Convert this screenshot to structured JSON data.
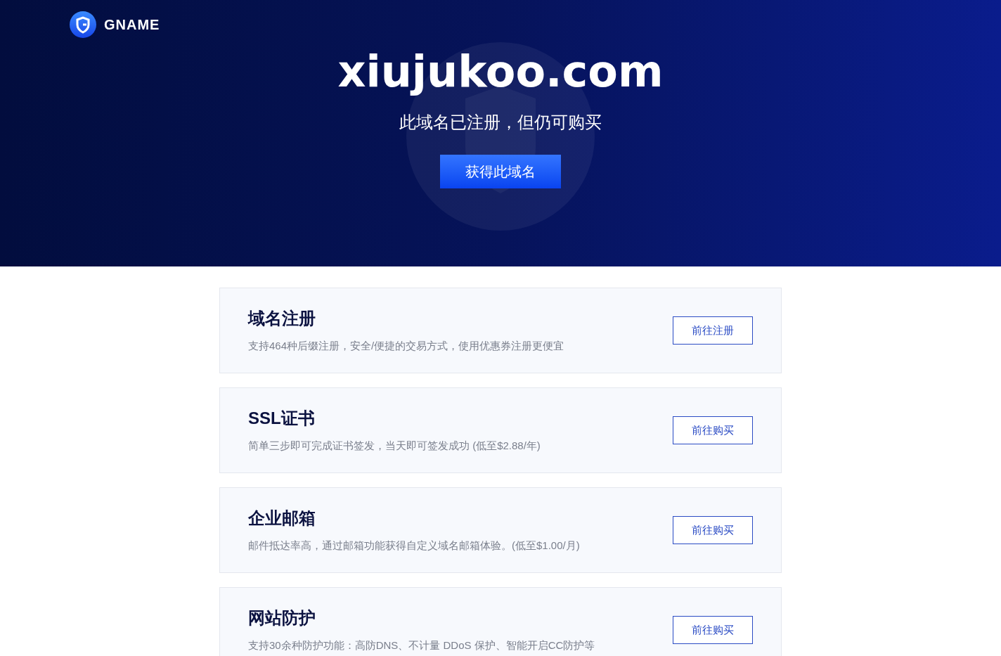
{
  "header": {
    "logo_text": "GNAME"
  },
  "hero": {
    "domain": "xiujukoo.com",
    "subtitle": "此域名已注册，但仍可购买",
    "button": "获得此域名"
  },
  "services": [
    {
      "title": "域名注册",
      "description": "支持464种后缀注册，安全/便捷的交易方式，使用优惠券注册更便宜",
      "button": "前往注册"
    },
    {
      "title": "SSL证书",
      "description": "简单三步即可完成证书签发，当天即可签发成功 (低至$2.88/年)",
      "button": "前往购买"
    },
    {
      "title": "企业邮箱",
      "description": "邮件抵达率高，通过邮箱功能获得自定义域名邮箱体验。(低至$1.00/月)",
      "button": "前往购买"
    },
    {
      "title": "网站防护",
      "description": "支持30余种防护功能：高防DNS、不计量 DDoS 保护、智能开启CC防护等",
      "button": "前往购买"
    }
  ]
}
